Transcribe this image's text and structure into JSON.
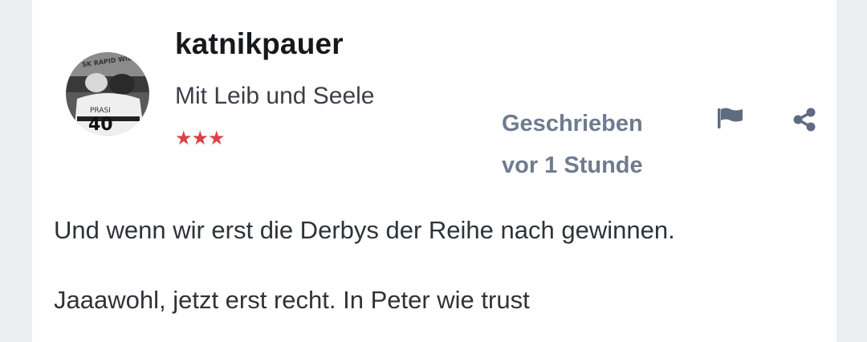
{
  "post": {
    "author": {
      "username": "katnikpauer",
      "title": "Mit Leib und Seele",
      "rank_stars": "★★★",
      "avatar": {
        "banner_text": "SK RAPID WIEN",
        "shirt_name": "PRASI",
        "shirt_number": "40"
      }
    },
    "meta": {
      "posted_label": "Geschrieben",
      "posted_time": "vor 1 Stunde"
    },
    "actions": {
      "report_icon": "flag-icon",
      "share_icon": "share-icon"
    },
    "body": [
      "Und wenn wir erst die Derbys der Reihe nach gewinnen.",
      "Jaaawohl, jetzt erst recht. In Peter wie trust"
    ]
  },
  "colors": {
    "page_background": "#eceef1",
    "card_background": "#ffffff",
    "username": "#16181c",
    "meta_text": "#6f7b8e",
    "stars": "#d9424a"
  }
}
